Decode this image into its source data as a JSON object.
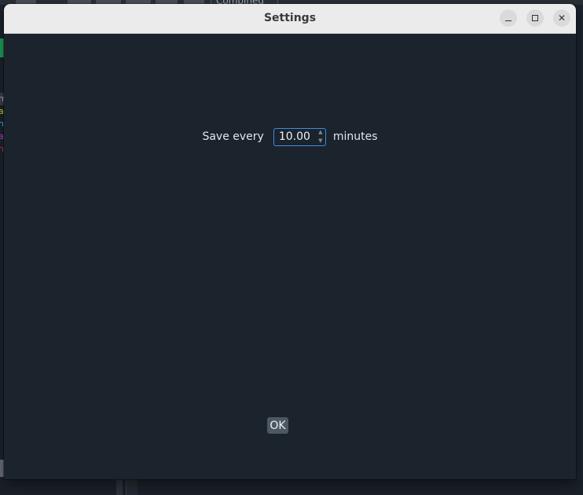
{
  "window": {
    "title": "Settings",
    "minimize_icon": "minimize-icon",
    "maximize_icon": "maximize-icon",
    "close_icon": "close-icon",
    "close_glyph": "✕"
  },
  "autosave": {
    "prefix_label": "Save every",
    "value": "10.00",
    "suffix_label": "minutes",
    "up_arrow": "▲",
    "down_arrow": "▼"
  },
  "actions": {
    "ok_label": "OK"
  },
  "background": {
    "combined_label": "Combined",
    "left_strip": [
      {
        "text": "m",
        "color": "#aab0b8"
      },
      {
        "text": "a",
        "color": "#e6d21c"
      },
      {
        "text": "n",
        "color": "#20c8d8"
      },
      {
        "text": "a",
        "color": "#d23cd2"
      },
      {
        "text": "n",
        "color": "#e0304a"
      }
    ]
  },
  "colors": {
    "dialog_bg": "#1b232d",
    "titlebar_bg": "#ebebeb",
    "spin_border": "#3d8de0",
    "ok_bg": "#4c5863"
  }
}
